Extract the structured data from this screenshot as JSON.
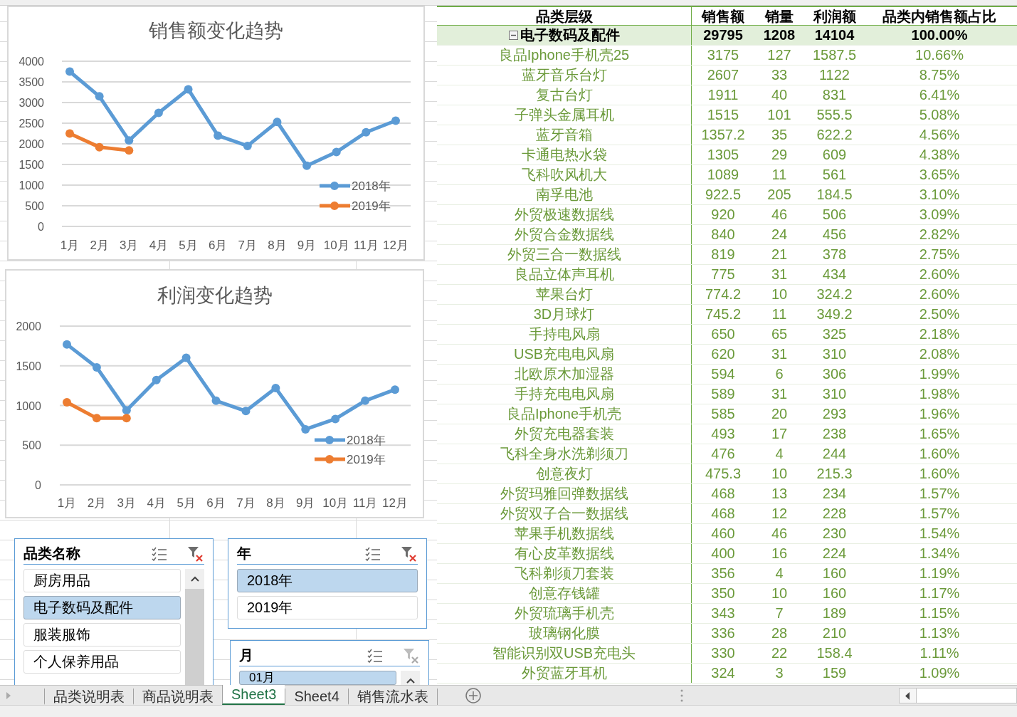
{
  "charts": [
    {
      "chart_data": {
        "type": "line",
        "title": "销售额变化趋势",
        "categories": [
          "1月",
          "2月",
          "3月",
          "4月",
          "5月",
          "6月",
          "7月",
          "8月",
          "9月",
          "10月",
          "11月",
          "12月"
        ],
        "ylim": [
          0,
          4000
        ],
        "yticks": [
          0,
          500,
          1000,
          1500,
          2000,
          2500,
          3000,
          3500,
          4000
        ],
        "grid": true,
        "legend": true,
        "series": [
          {
            "name": "2018年",
            "color": "#5b9bd5",
            "marker": "circle",
            "values": [
              3750,
              3150,
              2080,
              2750,
              3320,
              2200,
              1950,
              2530,
              1470,
              1800,
              2280,
              2560
            ]
          },
          {
            "name": "2019年",
            "color": "#ed7d31",
            "marker": "circle",
            "values": [
              2250,
              1920,
              1840,
              null,
              null,
              null,
              null,
              null,
              null,
              null,
              null,
              null
            ]
          }
        ]
      }
    },
    {
      "chart_data": {
        "type": "line",
        "title": "利润变化趋势",
        "categories": [
          "1月",
          "2月",
          "3月",
          "4月",
          "5月",
          "6月",
          "7月",
          "8月",
          "9月",
          "10月",
          "11月",
          "12月"
        ],
        "ylim": [
          0,
          2000
        ],
        "yticks": [
          0,
          500,
          1000,
          1500,
          2000
        ],
        "grid": true,
        "legend": true,
        "series": [
          {
            "name": "2018年",
            "color": "#5b9bd5",
            "marker": "circle",
            "values": [
              1770,
              1480,
              940,
              1320,
              1600,
              1060,
              930,
              1220,
              700,
              830,
              1060,
              1200
            ]
          },
          {
            "name": "2019年",
            "color": "#ed7d31",
            "marker": "circle",
            "values": [
              1040,
              840,
              840,
              null,
              null,
              null,
              null,
              null,
              null,
              null,
              null,
              null
            ]
          }
        ]
      }
    }
  ],
  "slicers": [
    {
      "title": "品类名称",
      "clear_filter_enabled": true,
      "scrollbar": true,
      "items": [
        {
          "label": "厨房用品",
          "selected": false
        },
        {
          "label": "电子数码及配件",
          "selected": true
        },
        {
          "label": "服装服饰",
          "selected": false
        },
        {
          "label": "个人保养用品",
          "selected": false
        }
      ]
    },
    {
      "title": "年",
      "clear_filter_enabled": true,
      "scrollbar": false,
      "items": [
        {
          "label": "2018年",
          "selected": true
        },
        {
          "label": "2019年",
          "selected": false
        }
      ]
    },
    {
      "title": "月",
      "clear_filter_enabled": false,
      "scrollbar": true,
      "items": [
        {
          "label": "01月",
          "selected": true
        }
      ]
    }
  ],
  "pivot": {
    "columns": [
      "品类层级",
      "销售额",
      "销量",
      "利润额",
      "品类内销售额占比"
    ],
    "total": {
      "label": "电子数码及配件",
      "expanded": true,
      "values": [
        "29795",
        "1208",
        "14104",
        "100.00%"
      ]
    },
    "rows": [
      [
        "良品Iphone手机壳25",
        "3175",
        "127",
        "1587.5",
        "10.66%"
      ],
      [
        "蓝牙音乐台灯",
        "2607",
        "33",
        "1122",
        "8.75%"
      ],
      [
        "复古台灯",
        "1911",
        "40",
        "831",
        "6.41%"
      ],
      [
        "子弹头金属耳机",
        "1515",
        "101",
        "555.5",
        "5.08%"
      ],
      [
        "蓝牙音箱",
        "1357.2",
        "35",
        "622.2",
        "4.56%"
      ],
      [
        "卡通电热水袋",
        "1305",
        "29",
        "609",
        "4.38%"
      ],
      [
        "飞科吹风机大",
        "1089",
        "11",
        "561",
        "3.65%"
      ],
      [
        "南孚电池",
        "922.5",
        "205",
        "184.5",
        "3.10%"
      ],
      [
        "外贸极速数据线",
        "920",
        "46",
        "506",
        "3.09%"
      ],
      [
        "外贸合金数据线",
        "840",
        "24",
        "456",
        "2.82%"
      ],
      [
        "外贸三合一数据线",
        "819",
        "21",
        "378",
        "2.75%"
      ],
      [
        "良品立体声耳机",
        "775",
        "31",
        "434",
        "2.60%"
      ],
      [
        "苹果台灯",
        "774.2",
        "10",
        "324.2",
        "2.60%"
      ],
      [
        "3D月球灯",
        "745.2",
        "11",
        "349.2",
        "2.50%"
      ],
      [
        "手持电风扇",
        "650",
        "65",
        "325",
        "2.18%"
      ],
      [
        "USB充电电风扇",
        "620",
        "31",
        "310",
        "2.08%"
      ],
      [
        "北欧原木加湿器",
        "594",
        "6",
        "306",
        "1.99%"
      ],
      [
        "手持充电电风扇",
        "589",
        "31",
        "310",
        "1.98%"
      ],
      [
        "良品Iphone手机壳",
        "585",
        "20",
        "293",
        "1.96%"
      ],
      [
        "外贸充电器套装",
        "493",
        "17",
        "238",
        "1.65%"
      ],
      [
        "飞科全身水洗剃须刀",
        "476",
        "4",
        "244",
        "1.60%"
      ],
      [
        "创意夜灯",
        "475.3",
        "10",
        "215.3",
        "1.60%"
      ],
      [
        "外贸玛雅回弹数据线",
        "468",
        "13",
        "234",
        "1.57%"
      ],
      [
        "外贸双子合一数据线",
        "468",
        "12",
        "228",
        "1.57%"
      ],
      [
        "苹果手机数据线",
        "460",
        "46",
        "230",
        "1.54%"
      ],
      [
        "有心皮革数据线",
        "400",
        "16",
        "224",
        "1.34%"
      ],
      [
        "飞科剃须刀套装",
        "356",
        "4",
        "160",
        "1.19%"
      ],
      [
        "创意存钱罐",
        "350",
        "10",
        "160",
        "1.17%"
      ],
      [
        "外贸琉璃手机壳",
        "343",
        "7",
        "189",
        "1.15%"
      ],
      [
        "玻璃钢化膜",
        "336",
        "28",
        "210",
        "1.13%"
      ],
      [
        "智能识别双USB充电头",
        "330",
        "22",
        "158.4",
        "1.11%"
      ],
      [
        "外贸蓝牙耳机",
        "324",
        "3",
        "159",
        "1.09%"
      ]
    ]
  },
  "sheet_tabs": [
    {
      "label": "品类说明表",
      "selected": false
    },
    {
      "label": "商品说明表",
      "selected": false
    },
    {
      "label": "Sheet3",
      "selected": true
    },
    {
      "label": "Sheet4",
      "selected": false
    },
    {
      "label": "销售流水表",
      "selected": false
    }
  ]
}
